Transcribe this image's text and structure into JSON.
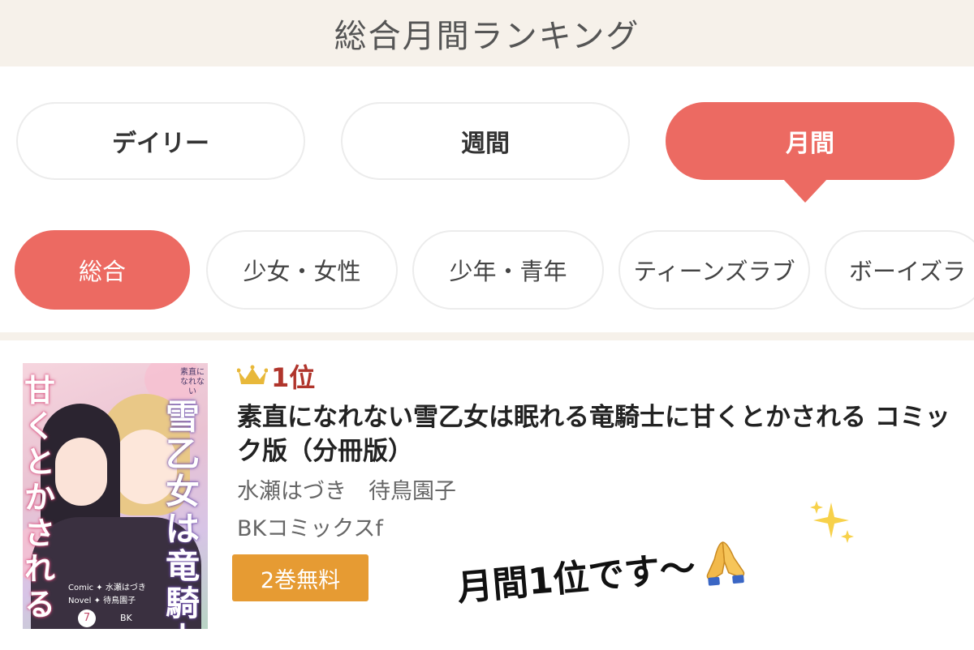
{
  "header": {
    "title": "総合月間ランキング"
  },
  "period_tabs": [
    {
      "label": "デイリー",
      "active": false
    },
    {
      "label": "週間",
      "active": false
    },
    {
      "label": "月間",
      "active": true
    }
  ],
  "genre_chips": [
    {
      "label": "総合",
      "active": true
    },
    {
      "label": "少女・女性",
      "active": false
    },
    {
      "label": "少年・青年",
      "active": false
    },
    {
      "label": "ティーンズラブ",
      "active": false
    },
    {
      "label": "ボーイズラ",
      "active": false
    }
  ],
  "ranking_item": {
    "rank_label": "1位",
    "title": "素直になれない雪乙女は眠れる竜騎士に甘くとかされる コミック版（分冊版）",
    "authors": "水瀬はづき　待鳥園子",
    "publisher": "BKコミックスf",
    "free_badge": "2巻無料",
    "cover": {
      "title_left": "甘くとかされる",
      "title_right": "雪乙女は竜騎士",
      "tagline": "素直になれない",
      "credit_comic": "Comic ✦ 水瀬はづき",
      "credit_novel": "Novel ✦ 待鳥園子",
      "volume": "7",
      "publisher_mark": "BK"
    }
  },
  "annotation": {
    "text": "月間1位です〜"
  },
  "icons": {
    "rank": "crown-icon",
    "annotation": [
      "pray-icon",
      "sparkle-icon"
    ]
  },
  "colors": {
    "accent": "#ec6a62",
    "rank_text": "#b0352c",
    "crown": "#e8b83a",
    "free_badge": "#e69b33",
    "header_bg": "#f6f1ea"
  }
}
